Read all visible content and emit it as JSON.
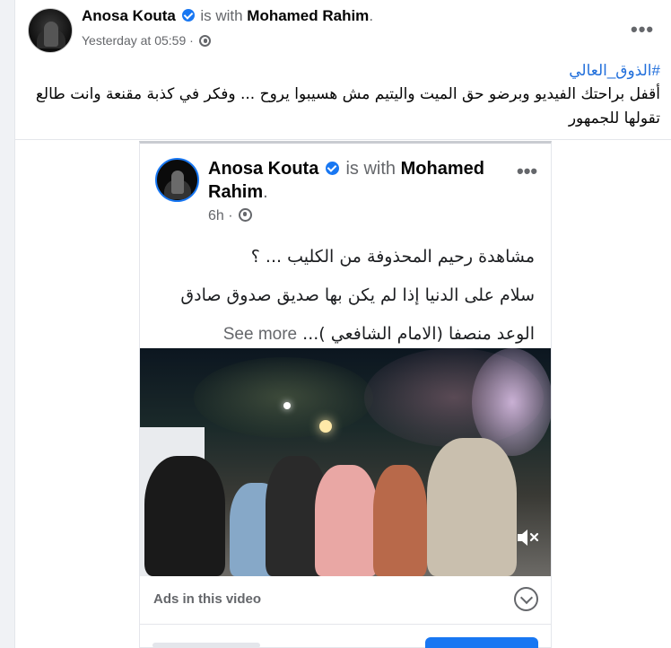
{
  "post": {
    "author": "Anosa Kouta",
    "with_label": "is with",
    "tagged": "Mohamed Rahim",
    "time": "Yesterday at 05:59",
    "hashtag": "#الذوق_العالي",
    "caption": "أقفل براحتك الفيديو وبرضو حق الميت واليتيم مش هسيبوا يروح ... وفكر في كذبة مقنعة وانت طالع تقولها للجمهور"
  },
  "shared": {
    "author": "Anosa Kouta",
    "with_label": "is with",
    "tagged": "Mohamed Rahim",
    "time": "6h",
    "lines": [
      "مشاهدة رحيم المحذوفة من الكليب ... ؟",
      "سلام على الدنيا إذا لم يكن بها صديق صدوق صادق",
      "الوعد منصفا (الامام الشافعي )..."
    ],
    "see_more": "See more",
    "ads_label": "Ads in this video"
  },
  "icons": {
    "verified": "verified-badge-icon",
    "audience": "globe-icon",
    "menu": "more-dots-icon",
    "mute": "speaker-muted-icon",
    "expand": "chevron-down-icon"
  },
  "colors": {
    "accent": "#1877f2",
    "hashtag": "#216fdb",
    "secondary_text": "#65676b"
  }
}
